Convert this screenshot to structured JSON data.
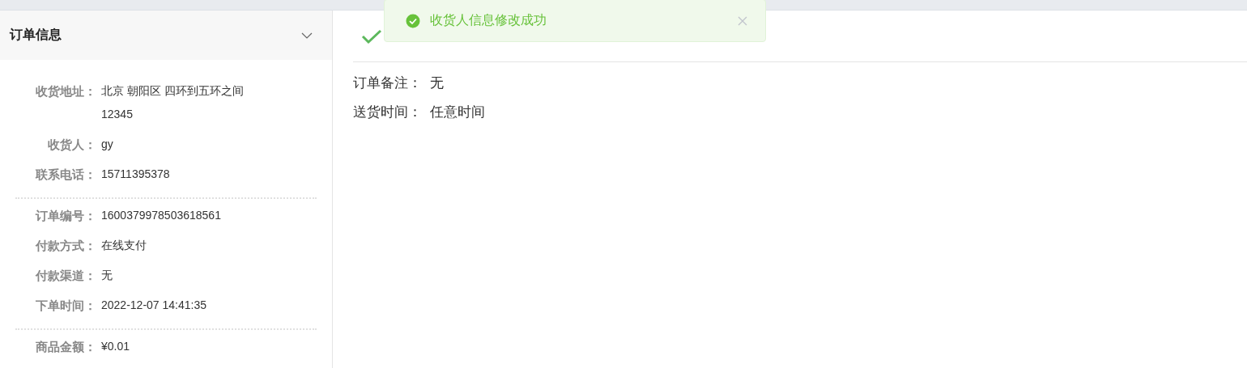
{
  "order_panel": {
    "title": "订单信息",
    "expanded": true,
    "groups": [
      [
        {
          "label": "收货地址：",
          "value_lines": [
            "北京 朝阳区 四环到五环之间",
            "12345"
          ]
        },
        {
          "label": "收货人：",
          "value_lines": [
            "gy"
          ]
        },
        {
          "label": "联系电话：",
          "value_lines": [
            "15711395378"
          ]
        }
      ],
      [
        {
          "label": "订单编号：",
          "value_lines": [
            "1600379978503618561"
          ]
        },
        {
          "label": "付款方式：",
          "value_lines": [
            "在线支付"
          ]
        },
        {
          "label": "付款渠道：",
          "value_lines": [
            "无"
          ]
        },
        {
          "label": "下单时间：",
          "value_lines": [
            "2022-12-07 14:41:35"
          ]
        }
      ],
      [
        {
          "label": "商品金额：",
          "value_lines": [
            "¥0.01"
          ]
        }
      ]
    ]
  },
  "content": {
    "fields": [
      {
        "label": "订单备注：",
        "value": "无"
      },
      {
        "label": "送货时间：",
        "value": "任意时间"
      }
    ]
  },
  "toast": {
    "kind": "success",
    "message": "收货人信息修改成功"
  }
}
